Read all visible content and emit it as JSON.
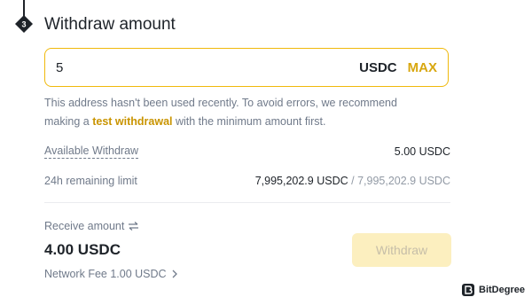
{
  "section": {
    "step_number": "3",
    "title": "Withdraw amount"
  },
  "amount": {
    "value": "5",
    "unit": "USDC",
    "max_label": "MAX"
  },
  "warning": {
    "text_before": "This address hasn't been used recently. To avoid errors, we recommend making a ",
    "link": "test withdrawal",
    "text_after": " with the minimum amount first."
  },
  "details": {
    "available_label": "Available Withdraw",
    "available_value": "5.00 USDC",
    "limit_label": "24h remaining limit",
    "limit_value": "7,995,202.9 USDC",
    "limit_separator": " / ",
    "limit_total": "7,995,202.9 USDC"
  },
  "receive": {
    "label": "Receive amount",
    "value": "4.00 USDC",
    "fee": "Network Fee 1.00 USDC",
    "button": "Withdraw"
  },
  "watermark": "BitDegree",
  "colors": {
    "accent": "#f0b90b",
    "link": "#c99400",
    "button_disabled": "#fcefbf"
  },
  "icons": [
    "step-badge-icon",
    "swap-arrows-icon",
    "chevron-right-icon",
    "bitdegree-logo-icon"
  ]
}
